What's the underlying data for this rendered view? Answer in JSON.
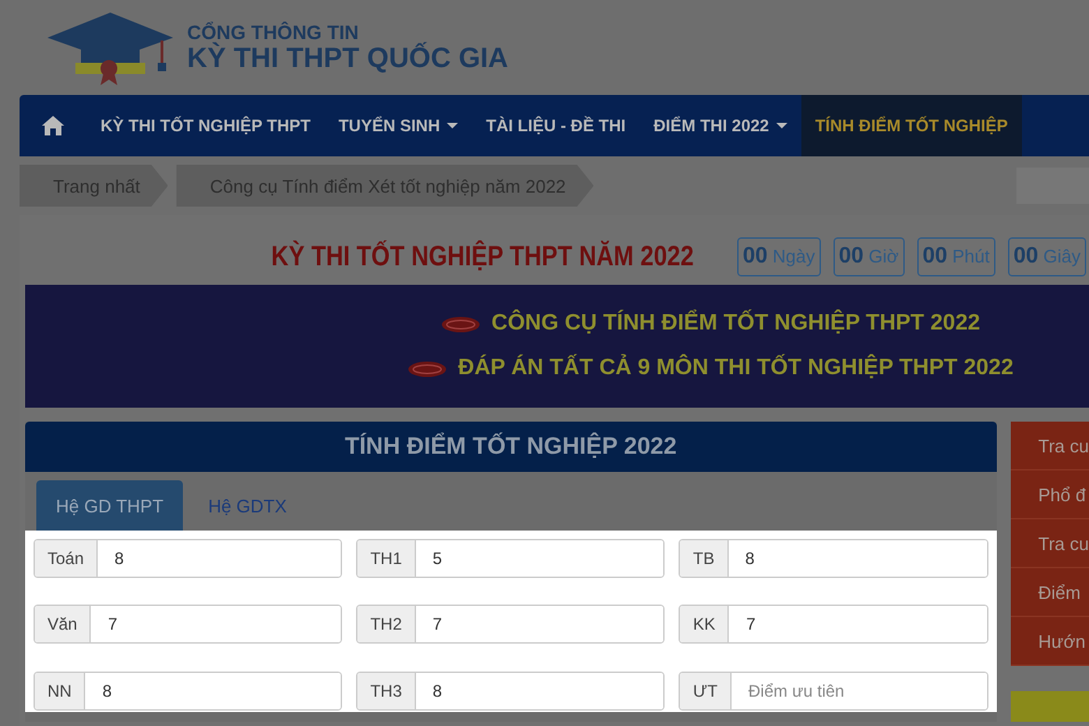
{
  "logo": {
    "line1": "CỔNG THÔNG TIN",
    "line2": "KỲ THI THPT QUỐC GIA"
  },
  "nav": [
    {
      "kind": "home",
      "selected": false
    },
    {
      "kind": "link",
      "label": "KỲ THI TỐT NGHIỆP THPT",
      "dropdown": false,
      "selected": false
    },
    {
      "kind": "link",
      "label": "TUYỂN SINH",
      "dropdown": true,
      "selected": false
    },
    {
      "kind": "link",
      "label": "TÀI LIỆU - ĐỀ THI",
      "dropdown": false,
      "selected": false
    },
    {
      "kind": "link",
      "label": "ĐIỂM THI 2022",
      "dropdown": true,
      "selected": false
    },
    {
      "kind": "link",
      "label": "TÍNH ĐIỂM TỐT NGHIỆP",
      "dropdown": false,
      "selected": true
    }
  ],
  "breadcrumb": [
    "Trang nhất",
    "Công cụ Tính điểm Xét tốt nghiệp năm 2022"
  ],
  "countdown": {
    "title": "KỲ THI TỐT NGHIỆP THPT NĂM 2022",
    "units": [
      "**00** Ngày",
      "**00** Giờ",
      "**00** Phút",
      "**00** Giây"
    ]
  },
  "banner_links": [
    "CÔNG CỤ TÍNH ĐIỂM TỐT NGHIỆP THPT 2022",
    "ĐÁP ÁN TẤT CẢ 9 MÔN THI TỐT NGHIỆP THPT 2022"
  ],
  "calculator": {
    "title": "TÍNH ĐIỂM TỐT NGHIỆP 2022",
    "tabs": [
      {
        "label": "Hệ GD THPT",
        "selected": true
      },
      {
        "label": "Hệ GDTX",
        "selected": false
      }
    ],
    "fields": [
      {
        "label": "Toán",
        "value": "8"
      },
      {
        "label": "TH1",
        "value": "5"
      },
      {
        "label": "TB",
        "value": "8"
      },
      {
        "label": "Văn",
        "value": "7"
      },
      {
        "label": "TH2",
        "value": "7"
      },
      {
        "label": "KK",
        "value": "7"
      },
      {
        "label": "NN",
        "value": "8"
      },
      {
        "label": "TH3",
        "value": "8"
      },
      {
        "label": "ƯT",
        "placeholder": "Điểm ưu tiên"
      }
    ]
  },
  "sidebar": [
    "Tra cu",
    "Phổ đ",
    "Tra cu",
    "Điểm",
    "Hướn"
  ]
}
